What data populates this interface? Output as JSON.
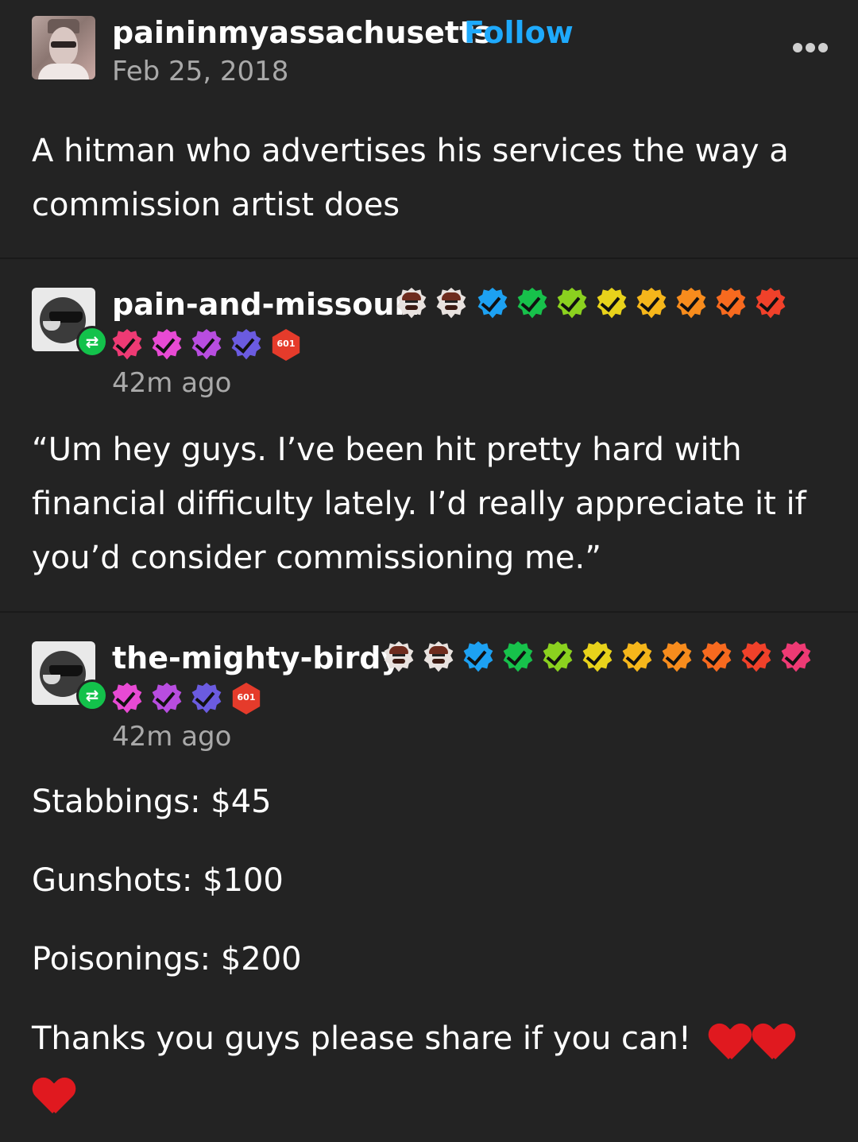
{
  "post": {
    "username": "paininmyassachusetts",
    "follow_label": "Follow",
    "date": "Feb 25, 2018",
    "text": "A hitman who advertises his services the way a commission artist does"
  },
  "reblogs": [
    {
      "username": "pain-and-missouri",
      "time": "42m ago",
      "text": "“Um hey guys. I’ve been hit pretty hard with financial difficulty lately. I’d really appreciate it if you’d consider commissioning me.”",
      "badge_dice_label": "601",
      "badge_colors_row1": [
        "#1da1f2",
        "#17c14b",
        "#8bd11f",
        "#e8d21b",
        "#f5b61b",
        "#f78c1d",
        "#f76a1f",
        "#f0412a"
      ],
      "badge_colors_row2": [
        "#ee3a74",
        "#e84ad4",
        "#b84de0",
        "#6b5be0"
      ]
    },
    {
      "username": "the-mighty-birdy",
      "time": "42m ago",
      "lines": [
        "Stabbings: $45",
        "Gunshots: $100",
        "Poisonings: $200",
        "Thanks you guys please share if you can!"
      ],
      "badge_dice_label": "601",
      "badge_colors_row1": [
        "#1da1f2",
        "#17c14b",
        "#8bd11f",
        "#e8d21b",
        "#f5b61b",
        "#f78c1d",
        "#f76a1f",
        "#f0412a",
        "#ee3a74"
      ],
      "badge_colors_row2": [
        "#e84ad4",
        "#b84de0",
        "#6b5be0"
      ]
    }
  ],
  "icons": {
    "more": "more-options-icon",
    "reblog": "reblog-icon",
    "heart": "red-heart-emoji"
  }
}
